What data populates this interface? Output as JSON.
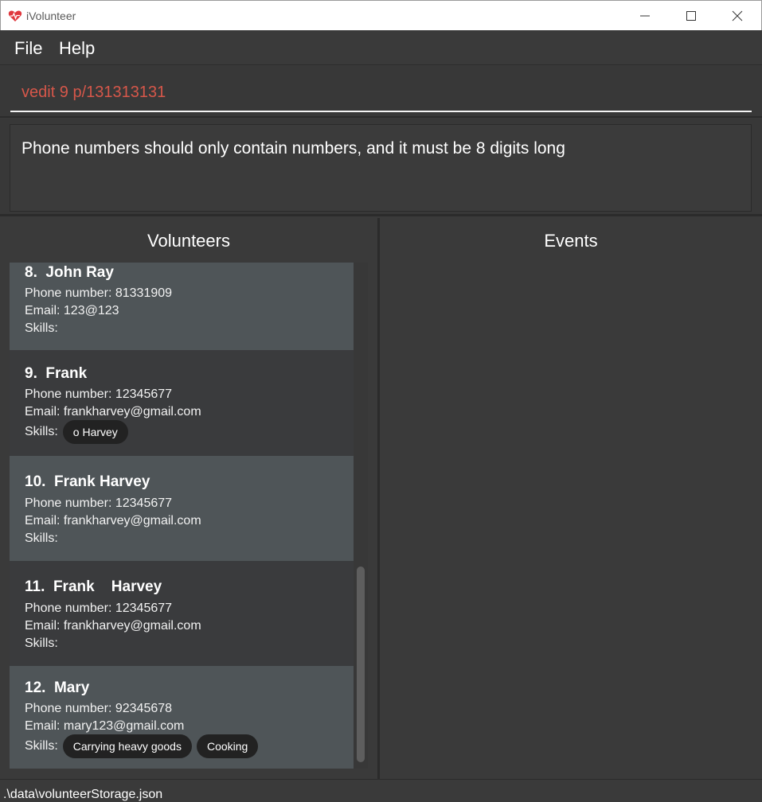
{
  "window": {
    "title": "iVolunteer",
    "icon": "heart-icon",
    "controls": [
      "minimize-icon",
      "maximize-icon",
      "close-icon"
    ]
  },
  "menu": {
    "file": "File",
    "help": "Help"
  },
  "command": {
    "value": "vedit 9 p/131313131",
    "color": "#d6574a"
  },
  "result": {
    "message": "Phone numbers should only contain numbers, and it must be 8 digits long"
  },
  "volunteers_panel": {
    "title": "Volunteers",
    "phone_label": "Phone number:",
    "email_label": "Email:",
    "skills_label": "Skills:",
    "cards": [
      {
        "index": "8.",
        "name": "John Ray",
        "phone": "81331909",
        "email": "123@123",
        "skills": []
      },
      {
        "index": "9.",
        "name": "Frank",
        "phone": "12345677",
        "email": "frankharvey@gmail.com",
        "skills": [
          "o Harvey"
        ]
      },
      {
        "index": "10.",
        "name": "Frank Harvey",
        "phone": "12345677",
        "email": "frankharvey@gmail.com",
        "skills": []
      },
      {
        "index": "11.",
        "name": "Frank    Harvey",
        "phone": "12345677",
        "email": "frankharvey@gmail.com",
        "skills": []
      },
      {
        "index": "12.",
        "name": "Mary",
        "phone": "92345678",
        "email": "mary123@gmail.com",
        "skills": [
          "Carrying heavy goods",
          "Cooking"
        ]
      }
    ]
  },
  "events_panel": {
    "title": "Events"
  },
  "status": {
    "path": ".\\data\\volunteerStorage.json"
  }
}
